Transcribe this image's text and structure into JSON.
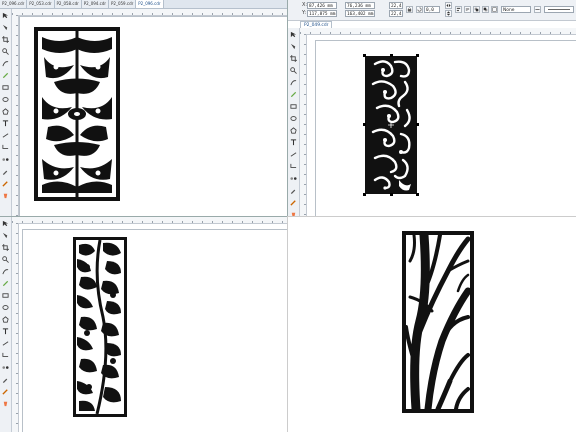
{
  "top_left_window": {
    "tabs": [
      {
        "label": "P2_096.cdr"
      },
      {
        "label": "P2_053.cdr"
      },
      {
        "label": "P2_058.cdr"
      },
      {
        "label": "P2_094.cdr"
      },
      {
        "label": "P2_059.cdr"
      },
      {
        "label": "P2_096.cdr"
      }
    ],
    "active_tab_index": 5
  },
  "top_right_window": {
    "object_x": "87,426 mm",
    "object_y": "117,875 mm",
    "object_width": "76,236 mm",
    "object_height": "163,402 mm",
    "scale_x": "22,4",
    "scale_y": "22,4",
    "rotation": "0,0",
    "outline_style": "None",
    "document_tab": "P2_049.cdr"
  },
  "colors": {
    "panel_fill": "#111111",
    "canvas": "#ffffff",
    "ui_chrome": "#eef1f5",
    "active_tab_text": "#1d4f8a"
  },
  "icons": [
    "pick-tool-icon",
    "shape-tool-icon",
    "crop-tool-icon",
    "zoom-tool-icon",
    "freehand-tool-icon",
    "artistic-media-icon",
    "rectangle-tool-icon",
    "ellipse-tool-icon",
    "polygon-tool-icon",
    "text-tool-icon",
    "parallel-dimension-icon",
    "connector-tool-icon",
    "blend-tool-icon",
    "eyedropper-icon",
    "outline-pen-icon",
    "fill-tool-icon",
    "mirror-horizontal-icon",
    "mirror-vertical-icon",
    "lock-ratio-icon"
  ]
}
